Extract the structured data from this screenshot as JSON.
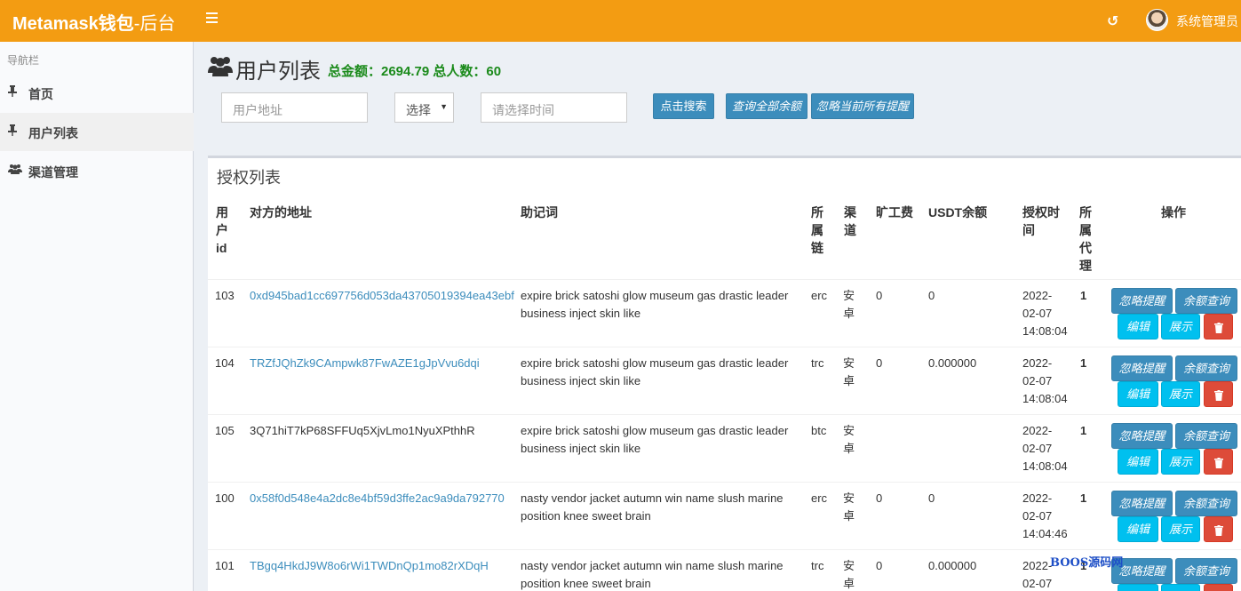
{
  "header": {
    "logo_bold": "Metamask钱包",
    "logo_rest": "-后台",
    "user_name": "系统管理员"
  },
  "sidebar": {
    "header": "导航栏",
    "items": [
      {
        "label": "首页",
        "icon": "pin-icon"
      },
      {
        "label": "用户列表",
        "icon": "pin-icon"
      },
      {
        "label": "渠道管理",
        "icon": "users-icon"
      }
    ]
  },
  "page": {
    "title": "用户列表",
    "summary": "总金额：2694.79 总人数：60"
  },
  "filters": {
    "address_placeholder": "用户地址",
    "select_value": "选择",
    "time_placeholder": "请选择时间",
    "search_button": "点击搜索",
    "query_all_button": "查询全部余额",
    "ignore_all_button": "忽略当前所有提醒"
  },
  "table": {
    "title": "授权列表",
    "headers": {
      "id": "用户id",
      "address": "对方的地址",
      "mnemonic": "助记词",
      "chain": "所属链",
      "channel": "渠道",
      "fee": "旷工费",
      "usdt": "USDT余额",
      "time": "授权时间",
      "agent": "所属代理",
      "actions": "操作"
    },
    "rows": [
      {
        "id": "103",
        "address": "0xd945bad1cc697756d053da43705019394ea43ebf",
        "mnemonic_1": "expire brick satoshi glow museum gas drastic leader",
        "mnemonic_2": "business inject skin like",
        "chain": "erc",
        "channel": "安卓",
        "fee": "0",
        "usdt": "0",
        "date": "2022-",
        "date2": "02-07",
        "time": "14:08:04",
        "agent": "1"
      },
      {
        "id": "104",
        "address": "TRZfJQhZk9CAmpwk87FwAZE1gJpVvu6dqi",
        "mnemonic_1": "expire brick satoshi glow museum gas drastic leader",
        "mnemonic_2": "business inject skin like",
        "chain": "trc",
        "channel": "安卓",
        "fee": "0",
        "usdt": "0.000000",
        "date": "2022-",
        "date2": "02-07",
        "time": "14:08:04",
        "agent": "1"
      },
      {
        "id": "105",
        "address": "3Q71hiT7kP68SFFUq5XjvLmo1NyuXPthhR",
        "mnemonic_1": "expire brick satoshi glow museum gas drastic leader",
        "mnemonic_2": "business inject skin like",
        "chain": "btc",
        "channel": "安卓",
        "fee": "",
        "usdt": "",
        "date": "2022-",
        "date2": "02-07",
        "time": "14:08:04",
        "agent": "1"
      },
      {
        "id": "100",
        "address": "0x58f0d548e4a2dc8e4bf59d3ffe2ac9a9da792770",
        "mnemonic_1": "nasty vendor jacket autumn win name slush marine",
        "mnemonic_2": "position knee sweet brain",
        "chain": "erc",
        "channel": "安卓",
        "fee": "0",
        "usdt": "0",
        "date": "2022-",
        "date2": "02-07",
        "time": "14:04:46",
        "agent": "1"
      },
      {
        "id": "101",
        "address": "TBgq4HkdJ9W8o6rWi1TWDnQp1mo82rXDqH",
        "mnemonic_1": "nasty vendor jacket autumn win name slush marine",
        "mnemonic_2": "position knee sweet brain",
        "chain": "trc",
        "channel": "安卓",
        "fee": "0",
        "usdt": "0.000000",
        "date": "2022-",
        "date2": "02-07",
        "time": "",
        "agent": "1"
      }
    ],
    "action_labels": {
      "ignore": "忽略提醒",
      "balance": "余额查询",
      "edit": "编辑",
      "show": "展示",
      "delete_icon": "trash-icon"
    }
  },
  "watermark": "BOOS源码网"
}
